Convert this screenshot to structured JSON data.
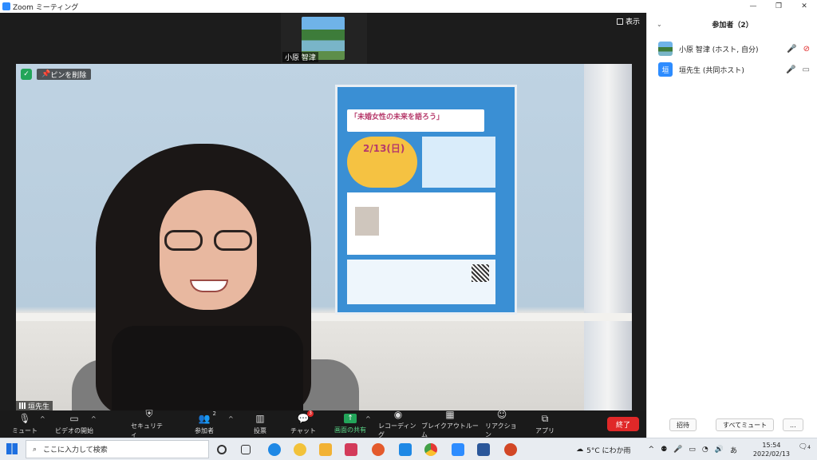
{
  "window": {
    "title": "Zoom ミーティング"
  },
  "thumbnail": {
    "name": "小原 智津"
  },
  "view_button": {
    "label": "表示"
  },
  "main_video": {
    "unpin_label": "ピンを削除",
    "speaker_name": "垣先生"
  },
  "poster": {
    "title": "「未婚女性の未来を語ろう」",
    "date": "2/13(日)"
  },
  "toolbar": {
    "mute": "ミュート",
    "video": "ビデオの開始",
    "security": "セキュリティ",
    "participants": "参加者",
    "participants_count": "2",
    "polls": "投票",
    "chat": "チャット",
    "chat_badge": "3",
    "share": "画面の共有",
    "record": "レコーディング",
    "breakout": "ブレイクアウトルーム",
    "reactions": "リアクション",
    "apps": "アプリ",
    "end": "終了"
  },
  "panel": {
    "title": "参加者（2）",
    "participants": [
      {
        "name": "小原 智津 (ホスト, 自分)"
      },
      {
        "name": "垣先生 (共同ホスト)",
        "avatar": "垣"
      }
    ],
    "invite": "招待",
    "mute_all": "すべてミュート",
    "more": "..."
  },
  "taskbar": {
    "search_placeholder": "ここに入力して検索",
    "weather": "5°C にわか雨",
    "ime": "あ",
    "time": "15:54",
    "date": "2022/02/13",
    "notifications": "4"
  },
  "colors": {
    "accent": "#2d8cff",
    "end": "#e02828",
    "share": "#23a55a"
  }
}
